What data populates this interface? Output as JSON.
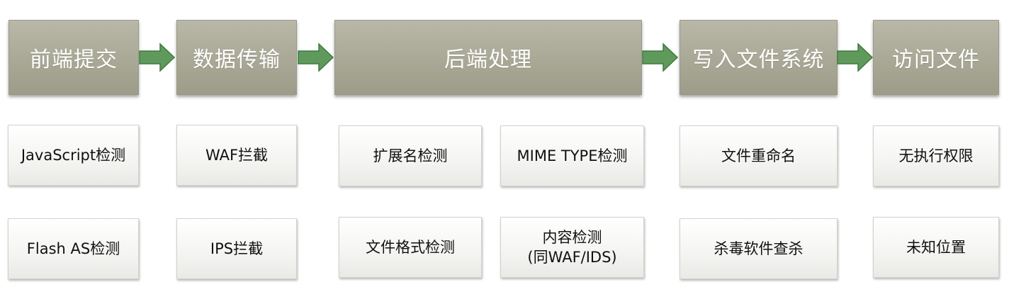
{
  "stages": [
    {
      "label": "前端提交"
    },
    {
      "label": "数据传输"
    },
    {
      "label": "后端处理"
    },
    {
      "label": "写入文件系统"
    },
    {
      "label": "访问文件"
    }
  ],
  "checks": {
    "frontend": [
      "JavaScript检测",
      "Flash AS检测"
    ],
    "transport": [
      "WAF拦截",
      "IPS拦截"
    ],
    "backend": [
      "扩展名检测",
      "MIME TYPE检测",
      "文件格式检测",
      "内容检测\n(同WAF/IDS)"
    ],
    "filesystem": [
      "文件重命名",
      "杀毒软件查杀"
    ],
    "access": [
      "无执行权限",
      "未知位置"
    ]
  },
  "colors": {
    "header": "#a9a896",
    "arrow": "#5f9a5c",
    "box": "#f4f4f2"
  }
}
